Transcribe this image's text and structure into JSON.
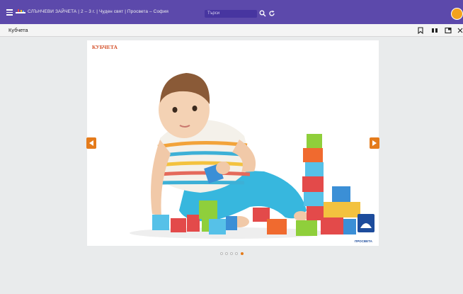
{
  "header": {
    "title": "СЛЪНЧЕВИ ЗАЙЧЕТА | 2 – 3 г. | Чуден свят | Просвета – София",
    "search_placeholder": "Търси"
  },
  "toolbar": {
    "label": "Кубчета"
  },
  "slide": {
    "caption": "КУБЧЕТА",
    "publisher": "ПРОСВЕТА"
  },
  "pagination": {
    "total": 5,
    "current": 5
  },
  "colors": {
    "header_bg": "#5c49ab",
    "accent": "#e47b1b",
    "caption": "#d4502a"
  }
}
